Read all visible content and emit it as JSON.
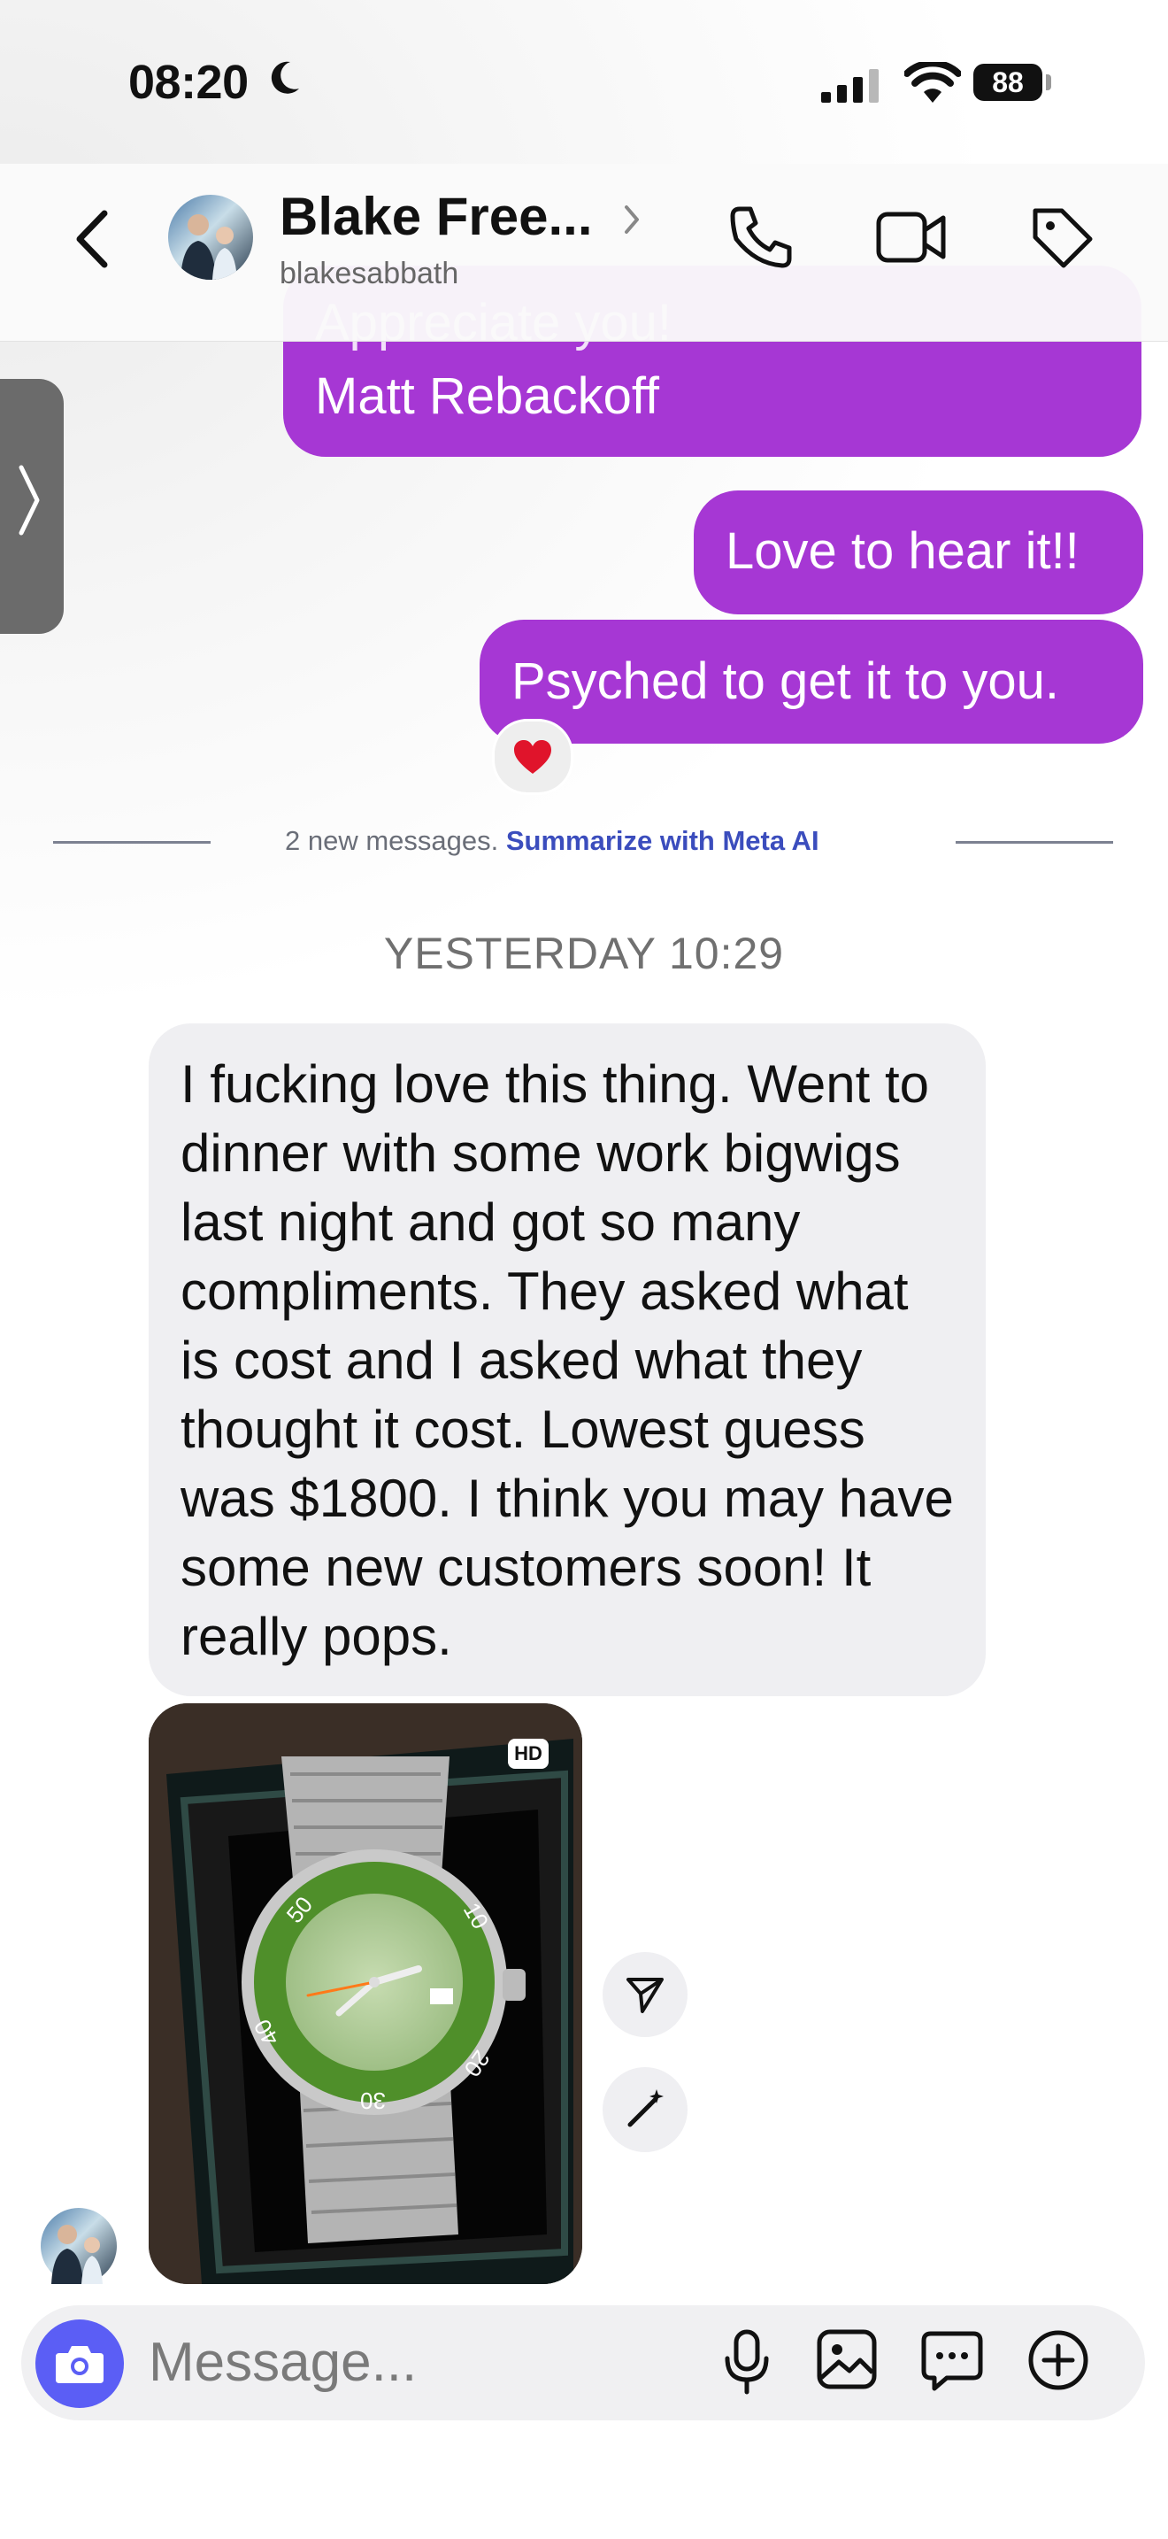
{
  "status": {
    "time": "08:20",
    "battery": "88"
  },
  "header": {
    "title": "Blake Free...",
    "subtitle": "blakesabbath"
  },
  "messages": {
    "outgoing": [
      {
        "hidden_line": "Appreciate you!",
        "line": "Matt Rebackoff"
      },
      {
        "text": "Love to hear it!!"
      },
      {
        "text": "Psyched to get it to you."
      }
    ],
    "reaction": "❤️"
  },
  "divider": {
    "prefix": "2 new messages. ",
    "link": "Summarize with Meta AI"
  },
  "timestamp": "YESTERDAY 10:29",
  "incoming": {
    "text": "I fucking love this thing. Went to dinner with some work bigwigs last night and got so many compliments. They asked what is cost and I asked what they thought it cost. Lowest guess was $1800. I think you may have some new customers soon! It really pops.",
    "photo_badge": "HD",
    "watch_bezel_numbers": [
      "50",
      "10",
      "20",
      "30",
      "40"
    ]
  },
  "composer": {
    "placeholder": "Message..."
  },
  "colors": {
    "outgoing_bubble": "#a637d4",
    "incoming_bubble": "#efeff2",
    "camera_button": "#5b5ef5",
    "link": "#3b4dbd"
  }
}
